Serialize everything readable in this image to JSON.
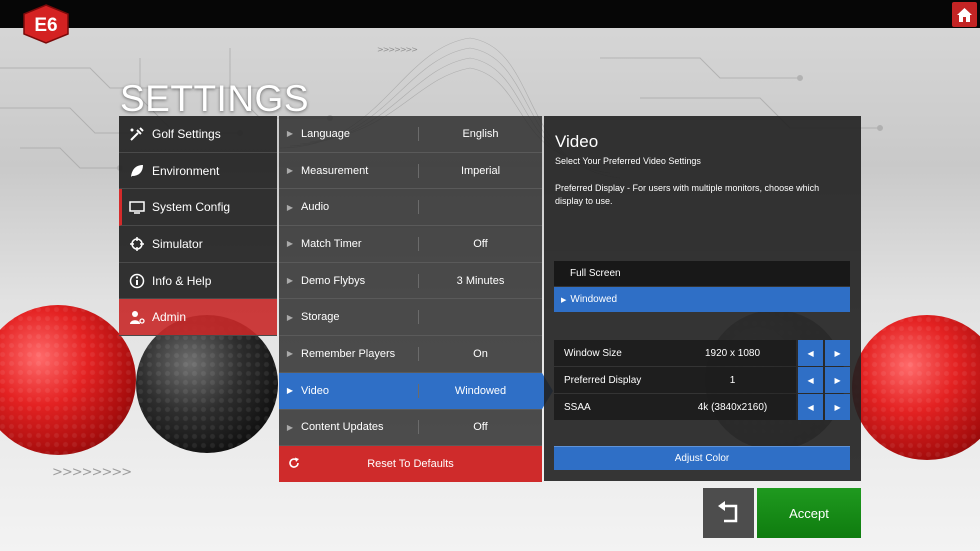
{
  "app": {
    "logo_text": "E6"
  },
  "title": "SETTINGS",
  "nav": [
    {
      "label": "Golf Settings",
      "icon": "golf-settings-icon"
    },
    {
      "label": "Environment",
      "icon": "leaf-icon"
    },
    {
      "label": "System Config",
      "icon": "monitor-icon",
      "selected": true
    },
    {
      "label": "Simulator",
      "icon": "crosshair-icon"
    },
    {
      "label": "Info & Help",
      "icon": "info-icon"
    },
    {
      "label": "Admin",
      "icon": "admin-user-icon"
    }
  ],
  "settings": [
    {
      "label": "Language",
      "value": "English"
    },
    {
      "label": "Measurement",
      "value": "Imperial"
    },
    {
      "label": "Audio",
      "value": ""
    },
    {
      "label": "Match Timer",
      "value": "Off"
    },
    {
      "label": "Demo Flybys",
      "value": "3 Minutes"
    },
    {
      "label": "Storage",
      "value": ""
    },
    {
      "label": "Remember Players",
      "value": "On"
    },
    {
      "label": "Video",
      "value": "Windowed",
      "active": true
    },
    {
      "label": "Content Updates",
      "value": "Off"
    }
  ],
  "reset_label": "Reset To Defaults",
  "detail": {
    "title": "Video",
    "subtitle": "Select Your Preferred Video Settings",
    "description": "Preferred Display - For users with multiple monitors, choose which display to use.",
    "modes": [
      {
        "label": "Full Screen",
        "selected": false
      },
      {
        "label": "Windowed",
        "selected": true
      }
    ],
    "params": [
      {
        "label": "Window Size",
        "value": "1920 x 1080"
      },
      {
        "label": "Preferred Display",
        "value": "1"
      },
      {
        "label": "SSAA",
        "value": "4k (3840x2160)"
      }
    ],
    "adjust_label": "Adjust Color"
  },
  "buttons": {
    "accept": "Accept"
  },
  "decor": {
    "chevrons": ">>>>>>>>",
    "chevrons_small": ">>>>>>>"
  },
  "colors": {
    "accent_blue": "#2f6fc6",
    "brand_red": "#cf2b2b",
    "accept_green": "#1a8f1a"
  }
}
